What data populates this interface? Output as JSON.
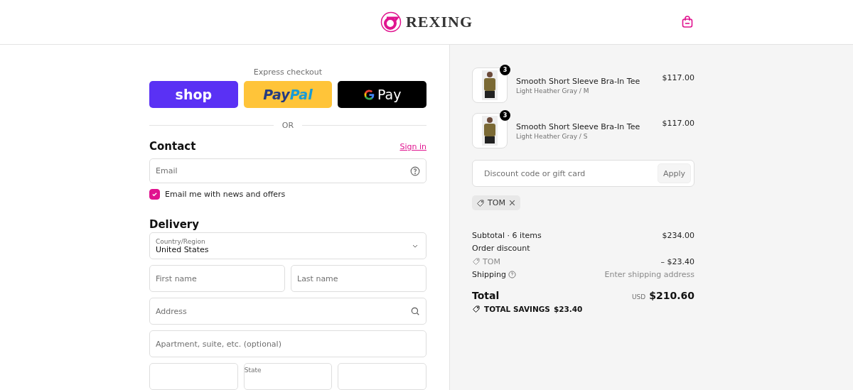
{
  "header": {
    "brand": "REXING"
  },
  "express": {
    "title": "Express checkout",
    "buttons": [
      {
        "kind": "shop",
        "parts": [
          "shop"
        ]
      },
      {
        "kind": "paypal",
        "parts": [
          "Pay",
          "Pal"
        ]
      },
      {
        "kind": "gpay",
        "parts": [
          "Pay"
        ]
      }
    ]
  },
  "divider": "OR",
  "contact": {
    "heading": "Contact",
    "link": "Sign in",
    "email": {
      "placeholder": "Email"
    },
    "newsletter": {
      "label": "Email me with news and offers",
      "checked": true
    }
  },
  "delivery": {
    "heading": "Delivery",
    "country": {
      "label": "Country/Region",
      "value": "United States"
    },
    "rows": [
      [
        {
          "placeholder": "First name"
        },
        {
          "placeholder": "Last name"
        }
      ],
      [
        {
          "placeholder": "Address",
          "kind": "search"
        }
      ],
      [
        {
          "placeholder": "Apartment, suite, etc. (optional)"
        }
      ],
      [
        {},
        {
          "label": "State"
        },
        {}
      ]
    ]
  },
  "order": {
    "items": [
      {
        "name": "Smooth Short Sleeve Bra-In Tee",
        "variant": "Light Heather Gray / M",
        "price": "$117.00",
        "quantity": "3"
      },
      {
        "name": "Smooth Short Sleeve Bra-In Tee",
        "variant": "Light Heather Gray / S",
        "price": "$117.00",
        "quantity": "3"
      }
    ],
    "discount": {
      "placeholder": "Discount code or gift card",
      "button": "Apply"
    },
    "applied_codes": [
      "TOM"
    ],
    "summary": [
      {
        "kind": "plain",
        "label": "Subtotal · 6 items",
        "value": "$234.00"
      },
      {
        "kind": "heading",
        "label": "Order discount"
      },
      {
        "kind": "code",
        "label": "TOM",
        "value": "– $23.40"
      },
      {
        "kind": "help",
        "label": "Shipping",
        "value": "Enter shipping address"
      }
    ],
    "total": {
      "label": "Total",
      "currency": "USD",
      "value": "$210.60"
    },
    "savings": {
      "label": "TOTAL SAVINGS",
      "value": "$23.40"
    }
  }
}
